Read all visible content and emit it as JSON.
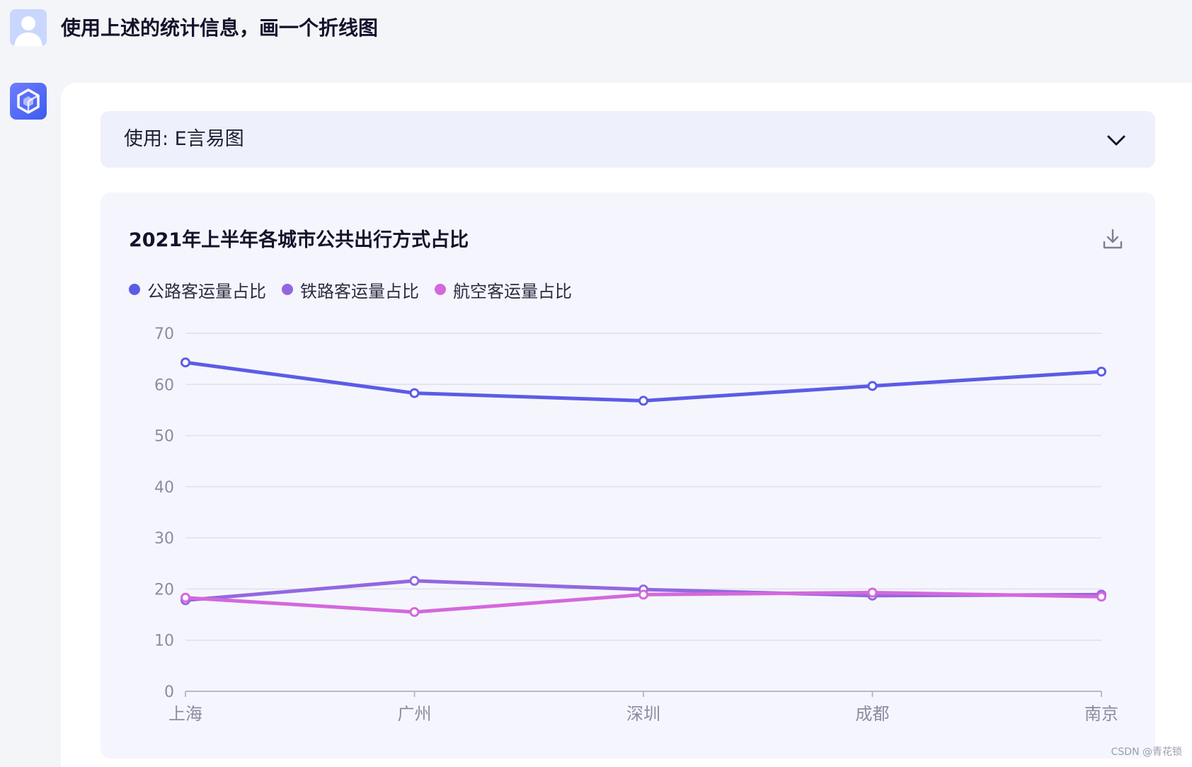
{
  "conversation": {
    "user_message": "使用上述的统计信息，画一个折线图",
    "plugin_label": "使用: E言易图"
  },
  "colors": {
    "road": "#5b5ce6",
    "rail": "#9268e0",
    "air": "#d468dc",
    "grid": "#dfe0ea",
    "axis": "#b8b9c8"
  },
  "icons": {
    "user_avatar": "user-avatar-icon",
    "bot_avatar": "cube-logo-icon",
    "chevron": "chevron-down-icon",
    "download": "download-icon"
  },
  "watermark": "CSDN @青花锁",
  "chart_data": {
    "type": "line",
    "title": "2021年上半年各城市公共出行方式占比",
    "categories": [
      "上海",
      "广州",
      "深圳",
      "成都",
      "南京"
    ],
    "series": [
      {
        "name": "公路客运量占比",
        "color": "#5b5ce6",
        "values": [
          64.3,
          58.3,
          56.8,
          59.7,
          62.5
        ]
      },
      {
        "name": "铁路客运量占比",
        "color": "#9268e0",
        "values": [
          17.8,
          21.6,
          19.9,
          18.7,
          18.9
        ]
      },
      {
        "name": "航空客运量占比",
        "color": "#d468dc",
        "values": [
          18.3,
          15.5,
          18.9,
          19.3,
          18.5
        ]
      }
    ],
    "ylim": [
      0,
      70
    ],
    "yticks": [
      0,
      10,
      20,
      30,
      40,
      50,
      60,
      70
    ],
    "grid": true,
    "legend_position": "top-left"
  }
}
